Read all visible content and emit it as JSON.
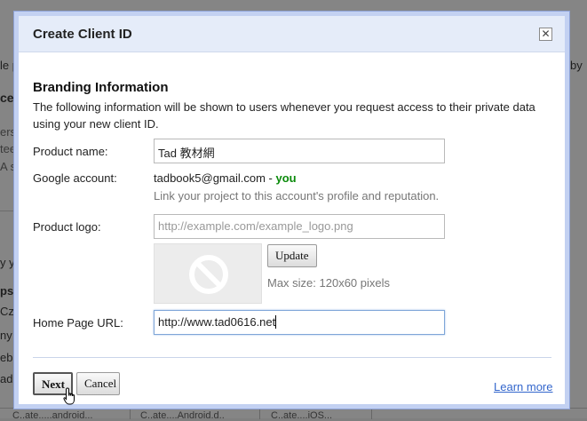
{
  "background": {
    "fragments": [
      "le p",
      "ces",
      "ers",
      "tee",
      "A s",
      "y y",
      "ps",
      "Cza",
      "ny r",
      "eb 2",
      "adb",
      "by"
    ],
    "bottom_tabs": [
      "C..ate.....android...",
      "C..ate....Android.d..",
      "C..ate....iOS..."
    ]
  },
  "dialog": {
    "title": "Create Client ID",
    "close_glyph": "✕",
    "section_title": "Branding Information",
    "description": "The following information will be shown to users whenever you request access to their private data using your new client ID.",
    "product_name": {
      "label": "Product name:",
      "value": "Tad 教材網"
    },
    "google_account": {
      "label": "Google account:",
      "email": "tadbook5@gmail.com",
      "separator": " - ",
      "you": "you",
      "hint": "Link your project to this account's profile and reputation."
    },
    "product_logo": {
      "label": "Product logo:",
      "placeholder": "http://example.com/example_logo.png",
      "update_label": "Update",
      "max_size": "Max size: 120x60 pixels"
    },
    "home_page_url": {
      "label": "Home Page URL:",
      "value": "http://www.tad0616.net"
    },
    "next_label": "Next",
    "cancel_label": "Cancel",
    "learn_more_label": "Learn more"
  },
  "colors": {
    "header_bg": "#e5ecf9",
    "border": "#c3d1f2",
    "link": "#3366cc",
    "you": "#0a8a0a"
  }
}
